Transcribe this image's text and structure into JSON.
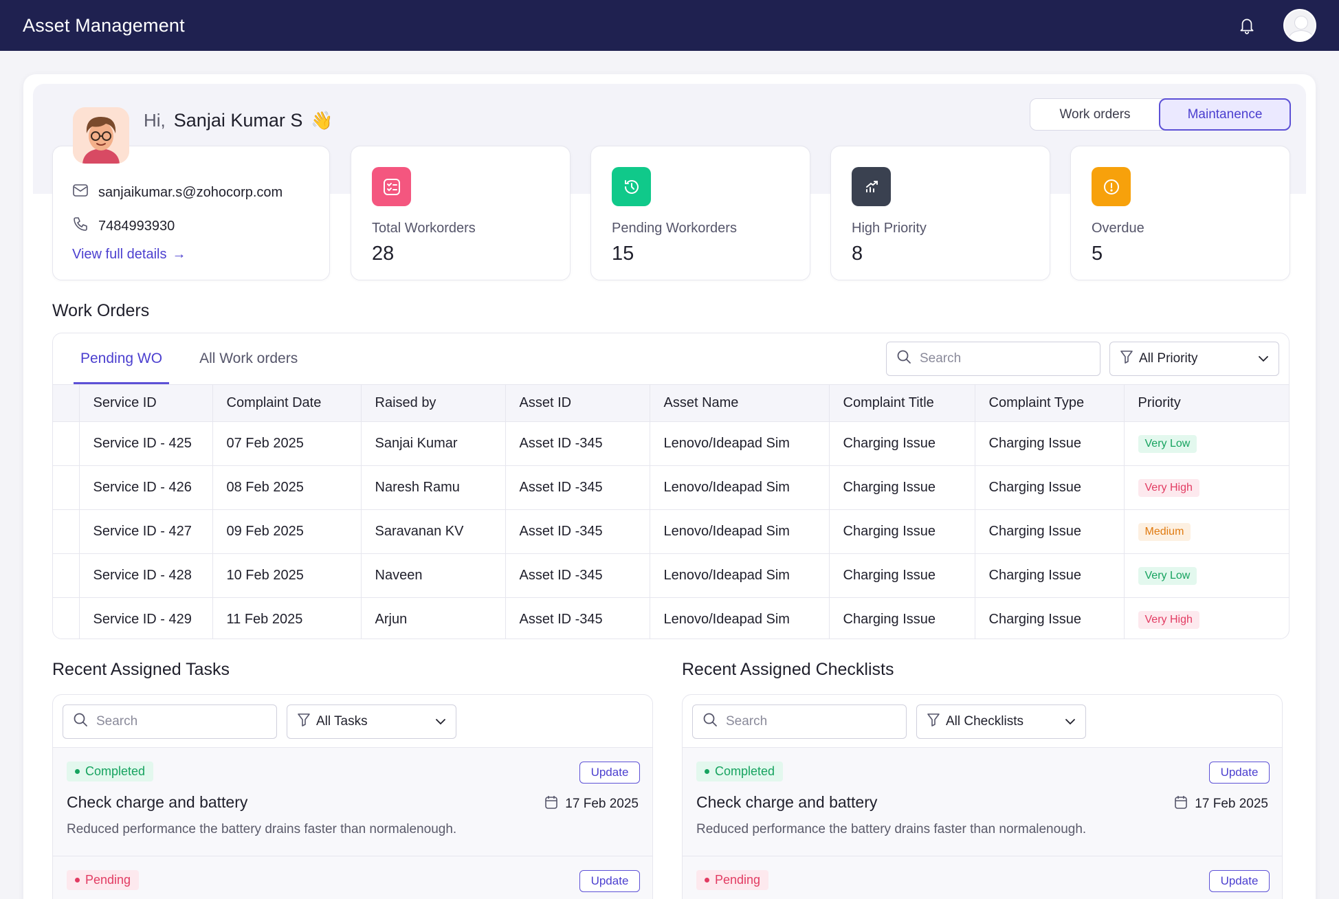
{
  "app": {
    "title": "Asset Management"
  },
  "header": {
    "bell_icon": "bell-icon",
    "avatar_icon": "user-avatar-icon"
  },
  "profile": {
    "greeting": "Hi,",
    "name": "Sanjai Kumar S",
    "wave": "👋",
    "email": "sanjaikumar.s@zohocorp.com",
    "phone": "7484993930",
    "details_link": "View full details",
    "details_arrow": "→"
  },
  "view_toggle": {
    "options": [
      "Work orders",
      "Maintanence"
    ],
    "active": "Maintanence"
  },
  "stats": [
    {
      "label": "Total Workorders",
      "value": "28",
      "color": "#f4567f",
      "icon": "checklist-icon"
    },
    {
      "label": "Pending Workorders",
      "value": "15",
      "color": "#10c98a",
      "icon": "clock-refresh-icon"
    },
    {
      "label": "High Priority",
      "value": "8",
      "color": "#3a4150",
      "icon": "trend-up-icon"
    },
    {
      "label": "Overdue",
      "value": "5",
      "color": "#f7a10b",
      "icon": "alert-circle-icon"
    }
  ],
  "work_orders": {
    "title": "Work Orders",
    "tabs": [
      "Pending WO",
      "All Work orders"
    ],
    "active_tab": "Pending WO",
    "search_placeholder": "Search",
    "filter_label": "All Priority",
    "columns": [
      "Service ID",
      "Complaint Date",
      "Raised by",
      "Asset ID",
      "Asset Name",
      "Complaint Title",
      "Complaint Type",
      "Priority"
    ],
    "rows": [
      [
        "Service ID - 425",
        "07 Feb 2025",
        "Sanjai Kumar",
        "Asset ID -345",
        "Lenovo/Ideapad Sim",
        "Charging Issue",
        "Charging Issue",
        "Very Low"
      ],
      [
        "Service ID - 426",
        "08 Feb 2025",
        "Naresh Ramu",
        "Asset ID -345",
        "Lenovo/Ideapad Sim",
        "Charging Issue",
        "Charging Issue",
        "Very High"
      ],
      [
        "Service ID - 427",
        "09 Feb 2025",
        "Saravanan KV",
        "Asset ID -345",
        "Lenovo/Ideapad Sim",
        "Charging Issue",
        "Charging Issue",
        "Medium"
      ],
      [
        "Service ID - 428",
        "10 Feb 2025",
        "Naveen",
        "Asset ID -345",
        "Lenovo/Ideapad Sim",
        "Charging Issue",
        "Charging Issue",
        "Very Low"
      ],
      [
        "Service ID - 429",
        "11 Feb 2025",
        "Arjun",
        "Asset ID -345",
        "Lenovo/Ideapad Sim",
        "Charging Issue",
        "Charging Issue",
        "Very High"
      ]
    ],
    "priority_colors": {
      "Very Low": "#16a35f",
      "Very High": "#e23b62",
      "Medium": "#e07a0f"
    }
  },
  "tasks": {
    "title": "Recent Assigned Tasks",
    "search_placeholder": "Search",
    "filter_label": "All Tasks",
    "items": [
      {
        "status": "Completed",
        "update": "Update",
        "title": "Check charge and battery",
        "date": "17 Feb 2025",
        "desc": "Reduced performance the battery drains faster than normalenough."
      },
      {
        "status": "Pending",
        "update": "Update"
      }
    ]
  },
  "checklists": {
    "title": "Recent Assigned Checklists",
    "search_placeholder": "Search",
    "filter_label": "All Checklists",
    "items": [
      {
        "status": "Completed",
        "update": "Update",
        "title": "Check charge and battery",
        "date": "17 Feb 2025",
        "desc": "Reduced performance the battery drains faster than normalenough."
      },
      {
        "status": "Pending",
        "update": "Update"
      }
    ]
  }
}
